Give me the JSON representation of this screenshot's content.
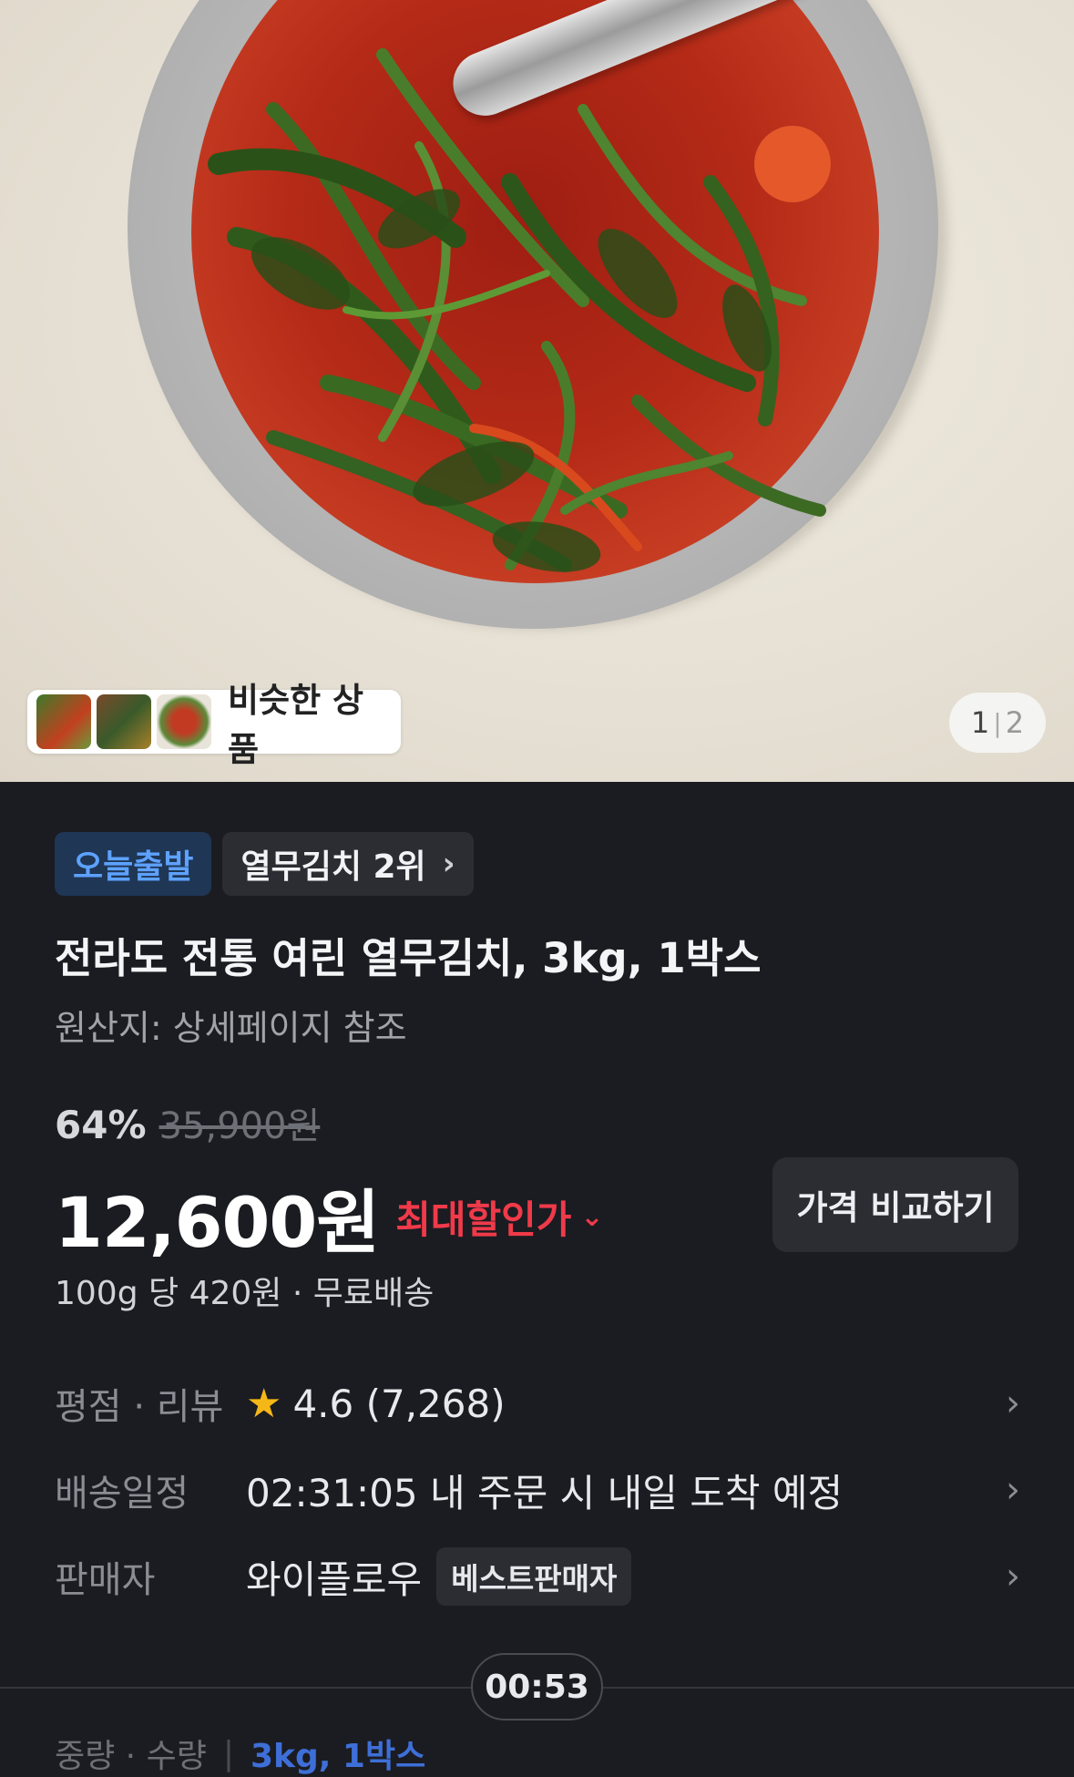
{
  "hero": {
    "similar_label": "비슷한 상품",
    "pager_current": "1",
    "pager_sep": "|",
    "pager_total": "2"
  },
  "badges": {
    "today": "오늘출발",
    "rank": "열무김치 2위",
    "rank_chevron": "›"
  },
  "product": {
    "title": "전라도 전통 여린 열무김치, 3kg, 1박스",
    "origin": "원산지: 상세페이지 참조",
    "discount": "64%",
    "original_price": "35,900원",
    "price": "12,600원",
    "max_discount": "최대할인가",
    "max_discount_chevron": "⌄",
    "compare_button": "가격 비교하기",
    "unit_info": "100g 당 420원 · 무료배송"
  },
  "info": {
    "rating_label": "평점 · 리뷰",
    "rating_value": "4.6 (7,268)",
    "delivery_label": "배송일정",
    "delivery_value": "02:31:05 내 주문 시 내일 도착 예정",
    "seller_label": "판매자",
    "seller_value": "와이플로우",
    "seller_badge": "베스트판매자",
    "chevron": "›"
  },
  "timer": "00:53",
  "options": {
    "label": "중량 · 수량",
    "pipe": "|",
    "value": "3kg, 1박스"
  },
  "icons": {
    "star": "star-icon",
    "chevron": "chevron-right-icon"
  },
  "colors": {
    "background": "#1b1c21",
    "today_badge_text": "#5da2ff",
    "max_discount": "#f03a4a",
    "star": "#f5b718"
  }
}
